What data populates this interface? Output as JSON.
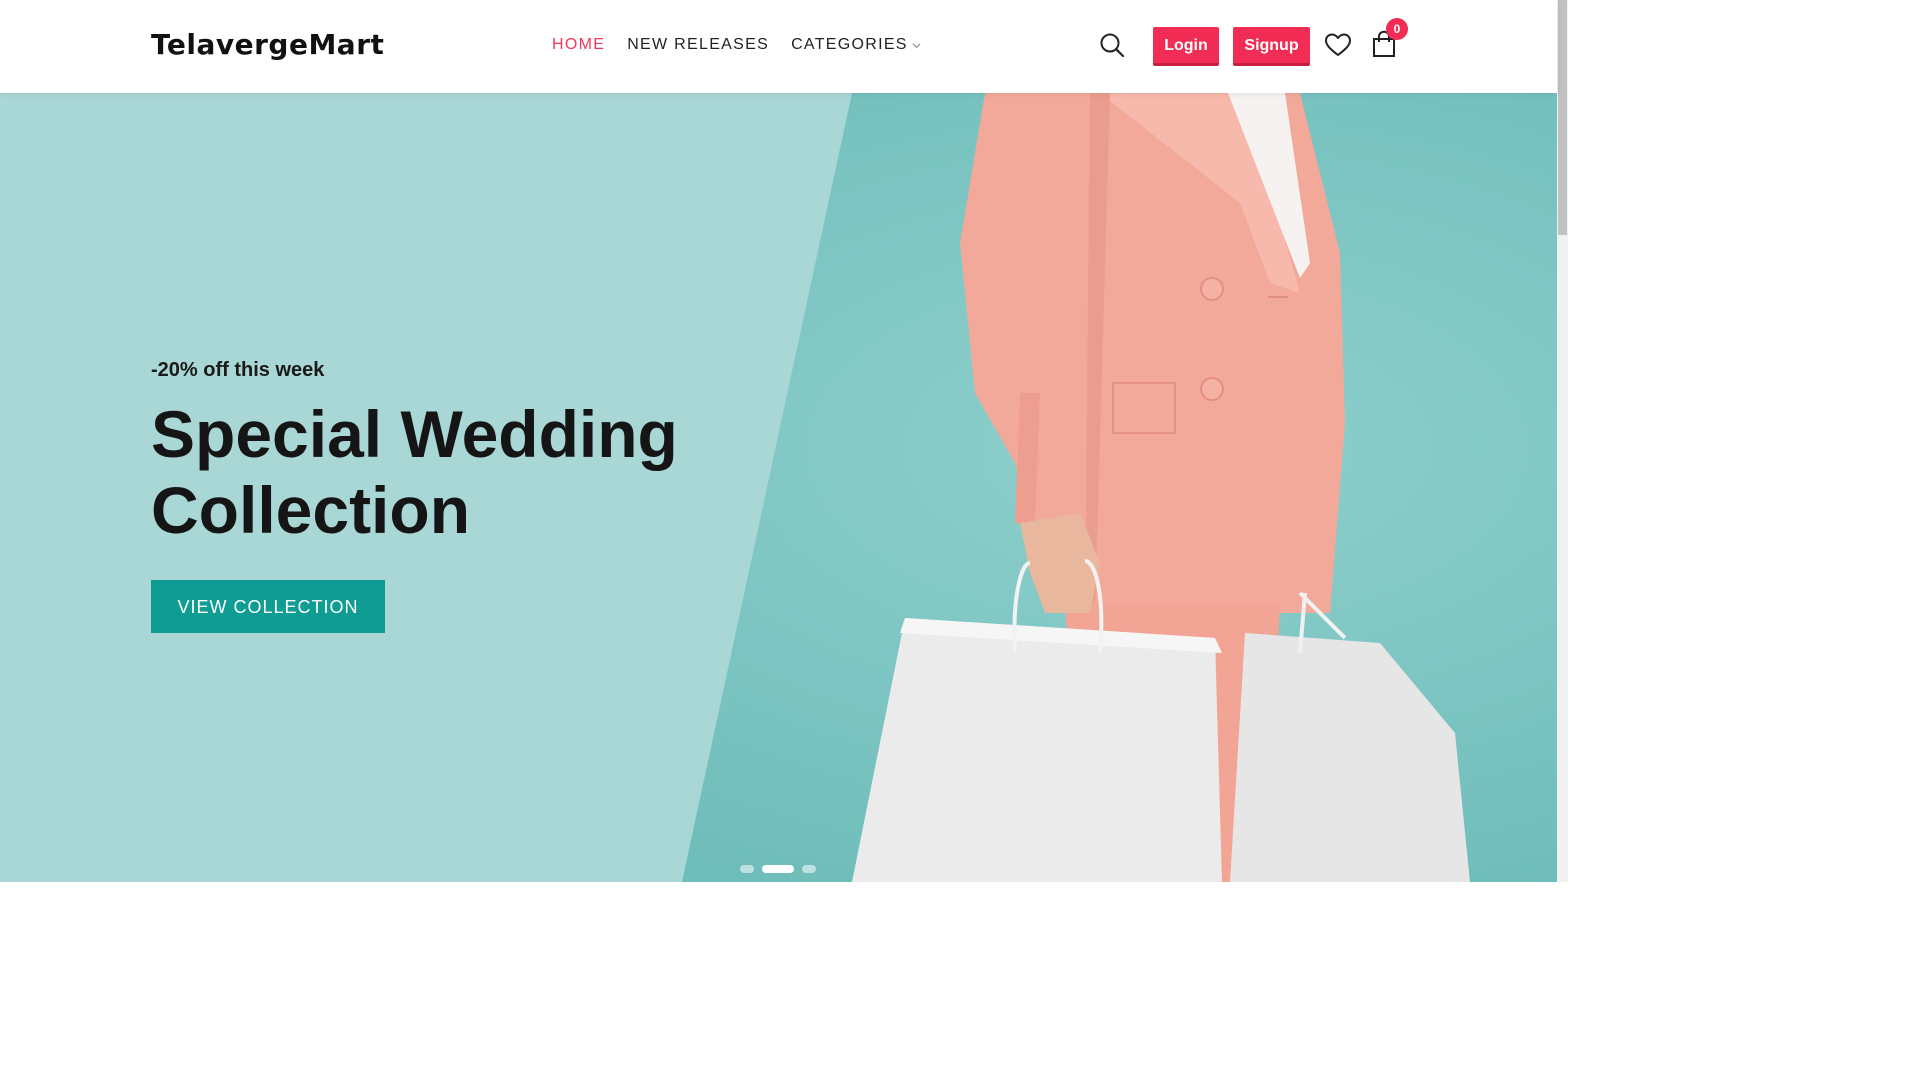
{
  "brand": {
    "logo_text": "TelavergeMart"
  },
  "nav": {
    "items": [
      {
        "label": "HOME",
        "active": true
      },
      {
        "label": "NEW RELEASES",
        "active": false
      },
      {
        "label": "CATEGORIES",
        "active": false,
        "has_dropdown": true
      }
    ]
  },
  "header_actions": {
    "search_icon": "search-icon",
    "login_label": "Login",
    "signup_label": "Signup",
    "wishlist_icon": "heart-icon",
    "cart_icon": "shopping-bag-icon",
    "cart_count": "0"
  },
  "hero": {
    "subtitle": "-20% off this week",
    "title": "Special Wedding Collection",
    "cta_label": "VIEW COLLECTION",
    "slides_total": 3,
    "active_slide": 2
  },
  "colors": {
    "accent": "#f12d55",
    "nav_active": "#ee3a5a",
    "cta": "#0e9c93",
    "hero_bg": "#7cc4c2",
    "hero_panel": "#a9d7d5",
    "coat": "#f3a99a"
  }
}
